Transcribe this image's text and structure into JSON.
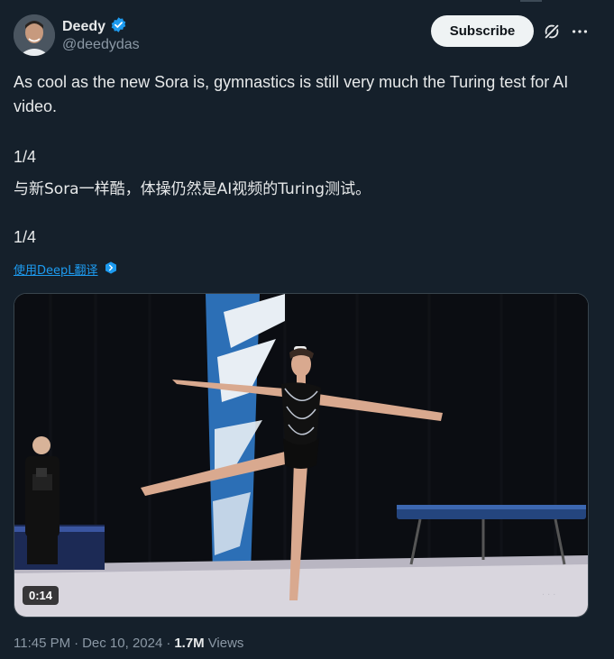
{
  "author": {
    "display_name": "Deedy",
    "handle": "@deedydas",
    "verified_icon": "verified-badge-icon"
  },
  "actions": {
    "subscribe_label": "Subscribe",
    "grok_icon": "grok-icon",
    "more_icon": "more-icon"
  },
  "post": {
    "line_en": "As cool as the new Sora is, gymnastics is still very much the Turing test for AI video.",
    "counter_1": "1/4",
    "line_zh": "与新Sora一样酷，体操仍然是AI视频的Turing测试。",
    "counter_2": "1/4",
    "translate_label": "使用DeepL翻译",
    "translate_icon": "deepl-icon"
  },
  "media": {
    "duration": "0:14"
  },
  "meta": {
    "time": "11:45 PM",
    "sep1": "·",
    "date": "Dec 10, 2024",
    "sep2": "·",
    "views_count": "1.7M",
    "views_label": "Views"
  },
  "colors": {
    "background": "#15202b",
    "link": "#1d9bf0",
    "verified": "#1d9bf0",
    "muted_text": "#8b98a5"
  }
}
